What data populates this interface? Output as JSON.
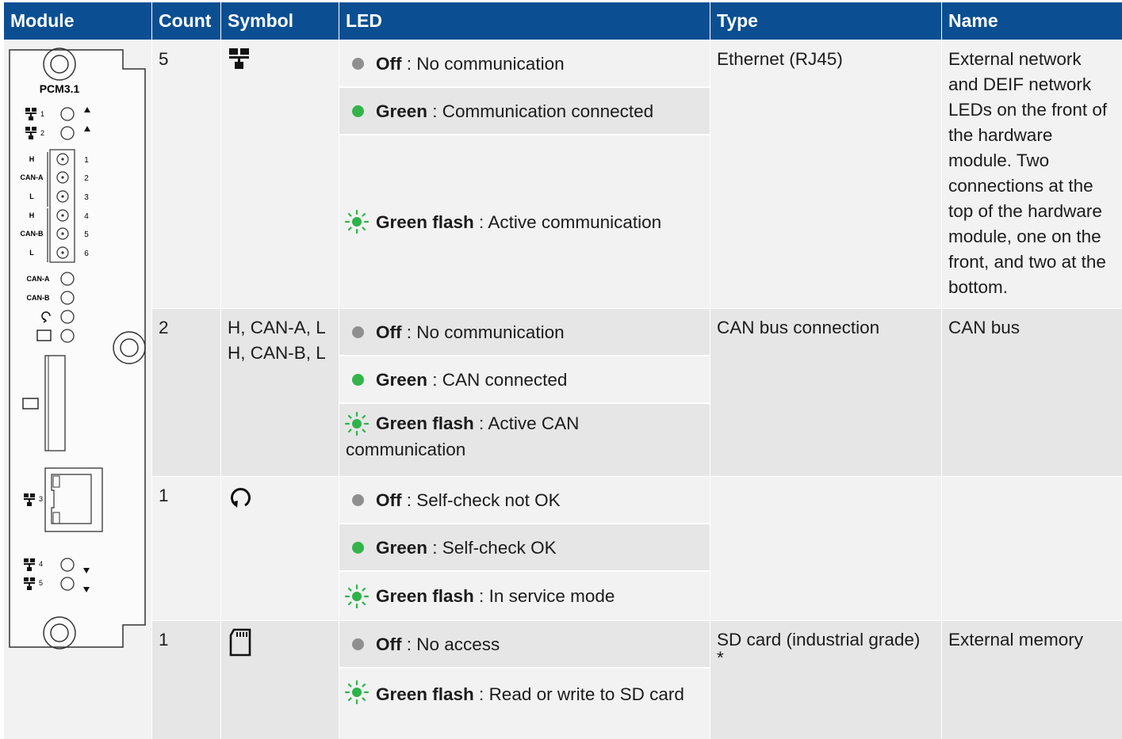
{
  "headers": {
    "module": "Module",
    "count": "Count",
    "symbol": "Symbol",
    "led": "LED",
    "type": "Type",
    "name": "Name"
  },
  "module_drawing": {
    "title": "PCM3.1",
    "net_1": "1",
    "net_2": "2",
    "net_3": "3",
    "net_4": "4",
    "net_5": "5",
    "pin_labels": [
      "H",
      "CAN-A",
      "L",
      "H",
      "CAN-B",
      "L"
    ],
    "pin_numbers": [
      "1",
      "2",
      "3",
      "4",
      "5",
      "6"
    ],
    "led_can_a": "CAN-A",
    "led_can_b": "CAN-B"
  },
  "rows": [
    {
      "count": "5",
      "symbol_icon": "ethernet-network-icon",
      "leds": [
        {
          "state": "Off",
          "sep": " : ",
          "desc": "No communication",
          "indicator": "grey-dot"
        },
        {
          "state": "Green",
          "sep": " : ",
          "desc": "Communication connected",
          "indicator": "green-dot"
        },
        {
          "state": "Green flash",
          "sep": " : ",
          "desc": "Active communication",
          "indicator": "green-flash"
        }
      ],
      "type": "Ethernet (RJ45)",
      "name": "External network and DEIF network LEDs on the front of the hardware module. Two connections at the top of the hardware module, one on the front, and two at the bottom."
    },
    {
      "count": "2",
      "symbol_text_1": "H, CAN-A, L",
      "symbol_text_2": "H, CAN-B, L",
      "leds": [
        {
          "state": "Off",
          "sep": " : ",
          "desc": "No communication",
          "indicator": "grey-dot"
        },
        {
          "state": "Green",
          "sep": " : ",
          "desc": "CAN connected",
          "indicator": "green-dot"
        },
        {
          "state": "Green flash",
          "sep": " : ",
          "desc": "Active CAN communication",
          "indicator": "green-flash"
        }
      ],
      "type": "CAN bus connection",
      "name": "CAN bus"
    },
    {
      "count": "1",
      "symbol_icon": "self-check-icon",
      "leds": [
        {
          "state": "Off",
          "sep": " : ",
          "desc": "Self-check not OK",
          "indicator": "grey-dot"
        },
        {
          "state": "Green",
          "sep": " : ",
          "desc": "Self-check OK",
          "indicator": "green-dot"
        },
        {
          "state": "Green flash",
          "sep": " : ",
          "desc": "In service mode",
          "indicator": "green-flash"
        }
      ],
      "type": "",
      "name": ""
    },
    {
      "count": "1",
      "symbol_icon": "sd-card-icon",
      "leds": [
        {
          "state": "Off",
          "sep": " : ",
          "desc": "No access",
          "indicator": "grey-dot"
        },
        {
          "state": "Green flash",
          "sep": " : ",
          "desc": "Read or write to SD card",
          "indicator": "green-flash"
        }
      ],
      "type": "SD card (industrial grade)",
      "type_note": "*",
      "name": "External memory"
    }
  ],
  "colors": {
    "header_bg": "#0b4f92",
    "led_green": "#33b44a",
    "led_grey": "#8f8f8f",
    "flash_green": "#2db34a"
  }
}
